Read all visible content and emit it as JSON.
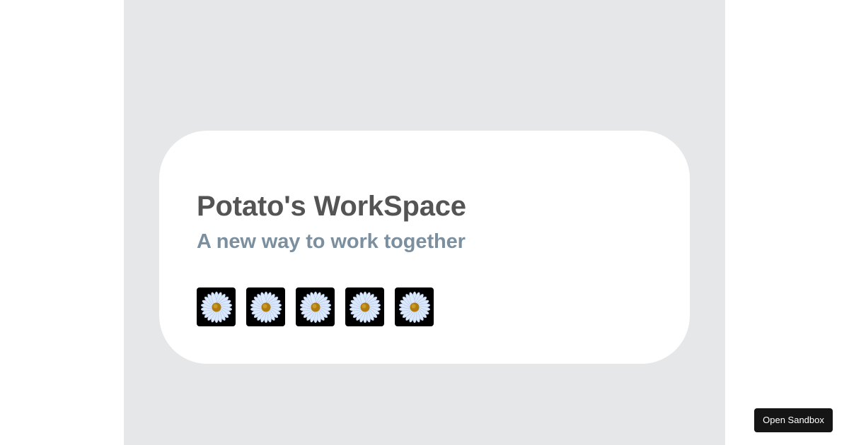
{
  "card": {
    "title": "Potato's WorkSpace",
    "subtitle": "A new way to work together"
  },
  "avatars": [
    {
      "icon": "daisy-icon"
    },
    {
      "icon": "daisy-icon"
    },
    {
      "icon": "daisy-icon"
    },
    {
      "icon": "daisy-icon"
    },
    {
      "icon": "daisy-icon"
    }
  ],
  "sandbox_button": {
    "label": "Open Sandbox"
  },
  "colors": {
    "page_background": "#ffffff",
    "stage_background": "#e5e7e9",
    "title": "#545454",
    "subtitle": "#7b8f9e",
    "avatar_background": "#000000",
    "petal": "#dce8fb",
    "flower_center": "#b07c10",
    "button_background": "#151515"
  }
}
